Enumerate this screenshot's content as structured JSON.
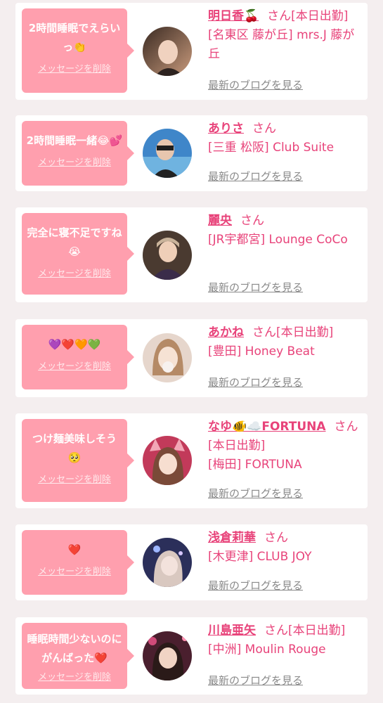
{
  "delete_label": "メッセージを削除",
  "blog_label": "最新のブログを見る",
  "honorific": "さん",
  "accent_color": "#e8437a",
  "bubble_color": "#ff9fae",
  "items": [
    {
      "message": "2時間睡眠でえらいっ👏",
      "name": "明日香🍒",
      "status": "[本日出勤]",
      "shop": "[名東区 藤が丘] mrs.J 藤が丘"
    },
    {
      "message": "2時間睡眠一緒😂💕",
      "name": "ありさ",
      "status": "",
      "shop": "[三重 松阪] Club Suite"
    },
    {
      "message": "完全に寝不足ですね😭",
      "name": "麗央",
      "status": "",
      "shop": "[JR宇都宮] Lounge CoCo"
    },
    {
      "message": "💜❤️🧡💚",
      "name": "あかね",
      "status": "[本日出勤]",
      "shop": "[豊田] Honey Beat"
    },
    {
      "message": "つけ麺美味しそう🥺",
      "name": "なゆ🐠☁️FORTUNA",
      "status": "[本日出勤]",
      "shop": "[梅田] FORTUNA"
    },
    {
      "message": "❤️",
      "name": "浅倉莉華",
      "status": "",
      "shop": "[木更津] CLUB JOY"
    },
    {
      "message": "睡眠時間少ないのにがんばった❤️",
      "name": "川島亜矢",
      "status": "[本日出勤]",
      "shop": "[中洲] Moulin Rouge"
    }
  ]
}
